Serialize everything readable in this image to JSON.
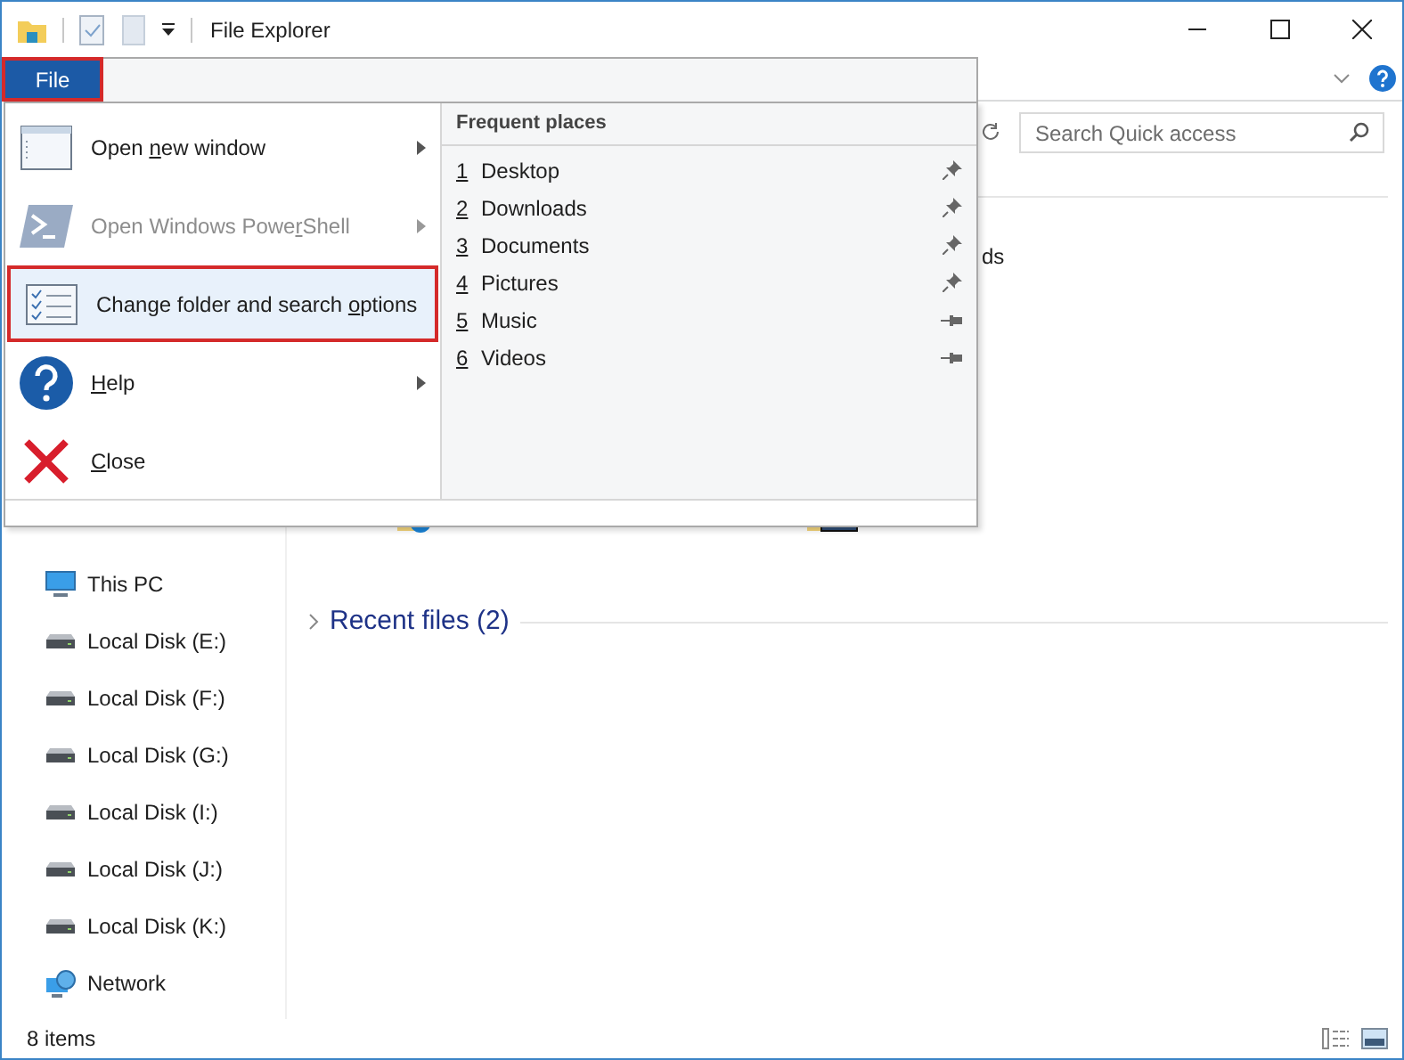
{
  "window": {
    "title": "File Explorer"
  },
  "file_tab": {
    "label": "File",
    "selected": true
  },
  "file_menu": {
    "items": [
      {
        "kind": "window",
        "label_parts": {
          "pre": "Open ",
          "key": "n",
          "post": "ew window"
        },
        "has_submenu": true,
        "disabled": false,
        "highlighted": false
      },
      {
        "kind": "powershell",
        "label_parts": {
          "pre": "Open Windows Powe",
          "key": "r",
          "post": "Shell"
        },
        "has_submenu": true,
        "disabled": true,
        "highlighted": false
      },
      {
        "kind": "options",
        "label_parts": {
          "pre": "Change folder and search ",
          "key": "o",
          "post": "ptions"
        },
        "has_submenu": false,
        "disabled": false,
        "highlighted": true
      },
      {
        "kind": "help",
        "label_parts": {
          "key": "H",
          "post": "elp"
        },
        "has_submenu": true,
        "disabled": false,
        "highlighted": false
      },
      {
        "kind": "close",
        "label_parts": {
          "key": "C",
          "post": "lose"
        },
        "has_submenu": false,
        "disabled": false,
        "highlighted": false
      }
    ],
    "frequent_places": {
      "heading": "Frequent places",
      "items": [
        {
          "number": "1",
          "name": "Desktop",
          "pinned": true
        },
        {
          "number": "2",
          "name": "Downloads",
          "pinned": true
        },
        {
          "number": "3",
          "name": "Documents",
          "pinned": true
        },
        {
          "number": "4",
          "name": "Pictures",
          "pinned": true
        },
        {
          "number": "5",
          "name": "Music",
          "pinned": false
        },
        {
          "number": "6",
          "name": "Videos",
          "pinned": false
        }
      ]
    }
  },
  "search": {
    "placeholder": "Search Quick access"
  },
  "content": {
    "tile_fragment": "ds",
    "recent_heading": "Recent files (2)"
  },
  "sidebar": {
    "items": [
      {
        "kind": "pc",
        "label": "This PC"
      },
      {
        "kind": "disk",
        "label": "Local Disk (E:)"
      },
      {
        "kind": "disk",
        "label": "Local Disk (F:)"
      },
      {
        "kind": "disk",
        "label": "Local Disk (G:)"
      },
      {
        "kind": "disk",
        "label": "Local Disk (I:)"
      },
      {
        "kind": "disk",
        "label": "Local Disk (J:)"
      },
      {
        "kind": "disk",
        "label": "Local Disk (K:)"
      },
      {
        "kind": "network",
        "label": "Network"
      }
    ]
  },
  "status_bar": {
    "count": "8 items"
  }
}
